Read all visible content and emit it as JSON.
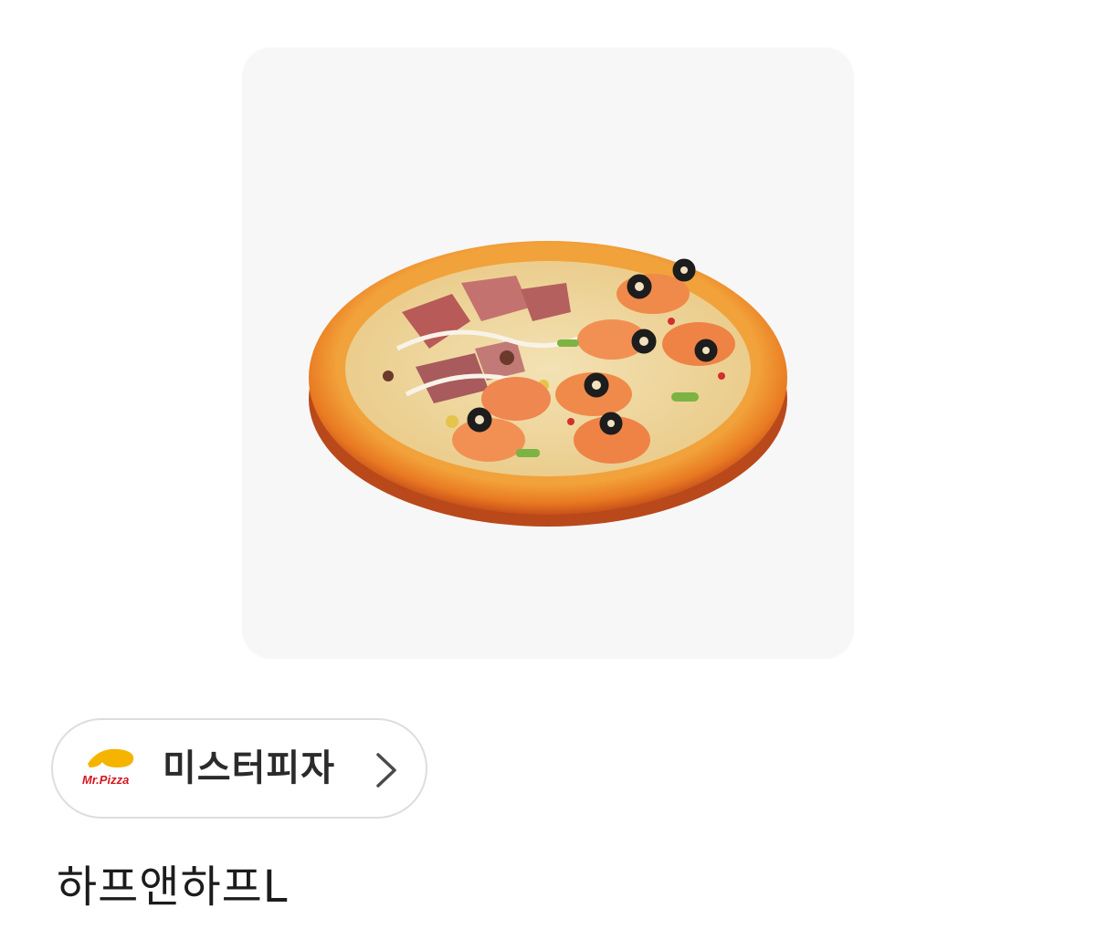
{
  "brand": {
    "name": "미스터피자",
    "logo_text": "Mr.Pizza",
    "logo_accent_color": "#f5b400",
    "logo_text_color": "#d5161e",
    "chevron_icon": "chevron-right-icon"
  },
  "product": {
    "title": "하프앤하프L",
    "image_icon": "pizza-image"
  }
}
